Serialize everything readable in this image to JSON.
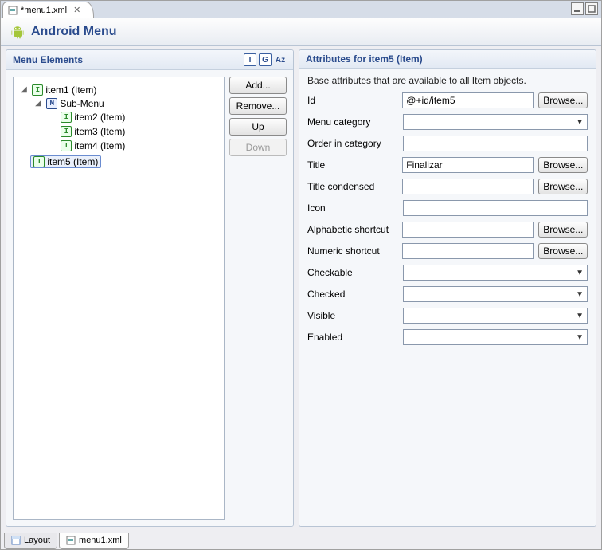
{
  "tab": {
    "title": "*menu1.xml"
  },
  "header": {
    "title": "Android Menu"
  },
  "leftPanel": {
    "title": "Menu Elements",
    "tools": {
      "i": "I",
      "g": "G",
      "az": "Az"
    },
    "buttons": {
      "add": "Add...",
      "remove": "Remove...",
      "up": "Up",
      "down": "Down"
    },
    "tree": {
      "item1": "item1 (Item)",
      "submenu": "Sub-Menu",
      "item2": "item2 (Item)",
      "item3": "item3 (Item)",
      "item4": "item4 (Item)",
      "item5": "item5 (Item)"
    }
  },
  "rightPanel": {
    "title": "Attributes for item5 (Item)",
    "description": "Base attributes that are available to all Item objects.",
    "labels": {
      "id": "Id",
      "menuCategory": "Menu category",
      "orderInCategory": "Order in category",
      "title": "Title",
      "titleCondensed": "Title condensed",
      "icon": "Icon",
      "alphaShortcut": "Alphabetic shortcut",
      "numShortcut": "Numeric shortcut",
      "checkable": "Checkable",
      "checked": "Checked",
      "visible": "Visible",
      "enabled": "Enabled"
    },
    "values": {
      "id": "@+id/item5",
      "menuCategory": "",
      "orderInCategory": "",
      "title": "Finalizar",
      "titleCondensed": "",
      "icon": "",
      "alphaShortcut": "",
      "numShortcut": "",
      "checkable": "",
      "checked": "",
      "visible": "",
      "enabled": ""
    },
    "browse": "Browse..."
  },
  "bottomTabs": {
    "layout": "Layout",
    "file": "menu1.xml"
  }
}
